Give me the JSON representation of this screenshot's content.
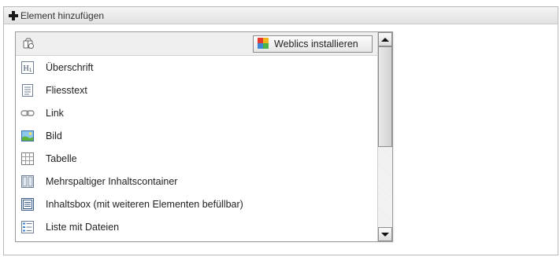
{
  "header": {
    "title": "Element hinzufügen",
    "icon": "plus-icon"
  },
  "toolbar": {
    "icon": "package-icon",
    "weblics_label": "Weblics installieren",
    "weblics_icon": "weblics-icon"
  },
  "items": [
    {
      "label": "Überschrift",
      "icon": "heading-icon"
    },
    {
      "label": "Fliesstext",
      "icon": "text-icon"
    },
    {
      "label": "Link",
      "icon": "link-icon"
    },
    {
      "label": "Bild",
      "icon": "image-icon"
    },
    {
      "label": "Tabelle",
      "icon": "table-icon"
    },
    {
      "label": "Mehrspaltiger Inhaltscontainer",
      "icon": "columns-icon"
    },
    {
      "label": "Inhaltsbox (mit weiteren Elementen befüllbar)",
      "icon": "contentbox-icon"
    },
    {
      "label": "Liste mit Dateien",
      "icon": "file-list-icon"
    }
  ]
}
